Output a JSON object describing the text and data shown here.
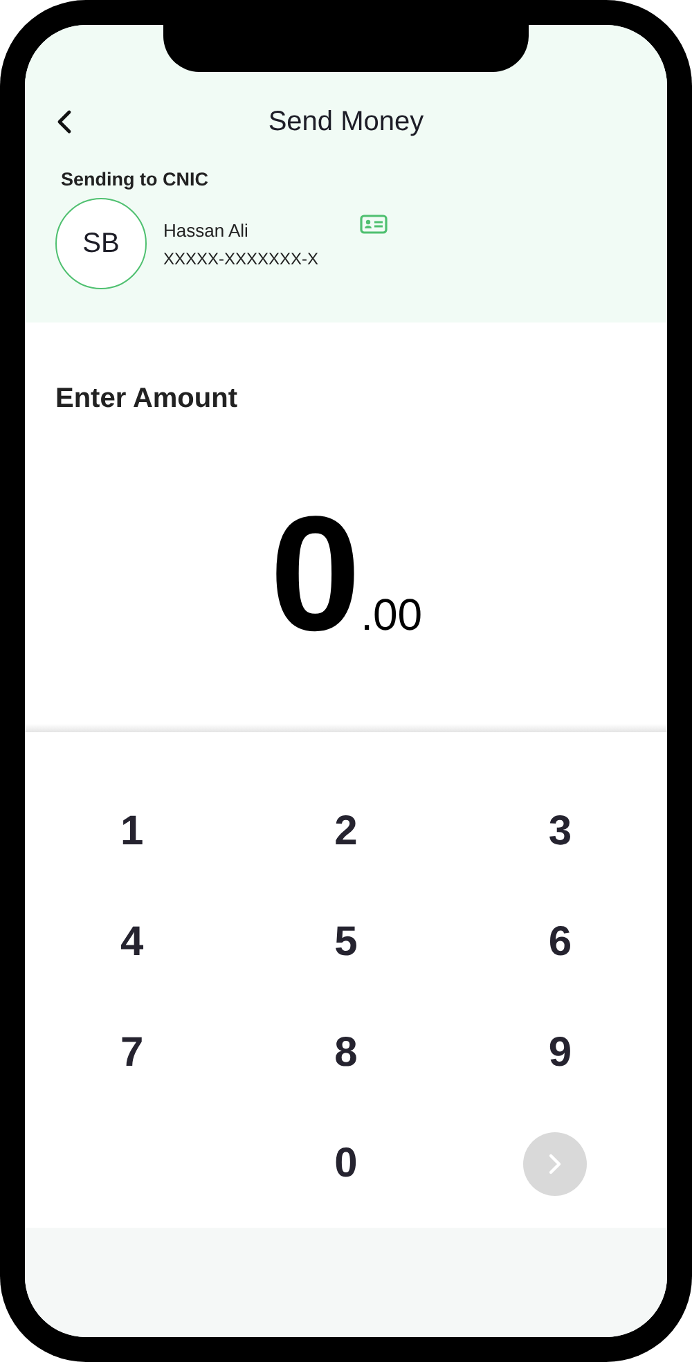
{
  "header": {
    "title": "Send Money"
  },
  "recipient": {
    "label": "Sending to CNIC",
    "initials": "SB",
    "name": "Hassan Ali",
    "cnic": "XXXXX-XXXXXXX-X"
  },
  "amount": {
    "label": "Enter Amount",
    "whole": "0",
    "decimal": ".00"
  },
  "keypad": [
    {
      "kind": "digit",
      "label": "1"
    },
    {
      "kind": "digit",
      "label": "2"
    },
    {
      "kind": "digit",
      "label": "3"
    },
    {
      "kind": "digit",
      "label": "4"
    },
    {
      "kind": "digit",
      "label": "5"
    },
    {
      "kind": "digit",
      "label": "6"
    },
    {
      "kind": "digit",
      "label": "7"
    },
    {
      "kind": "digit",
      "label": "8"
    },
    {
      "kind": "digit",
      "label": "9"
    },
    {
      "kind": "blank"
    },
    {
      "kind": "digit",
      "label": "0"
    },
    {
      "kind": "next",
      "disabled": true
    }
  ]
}
